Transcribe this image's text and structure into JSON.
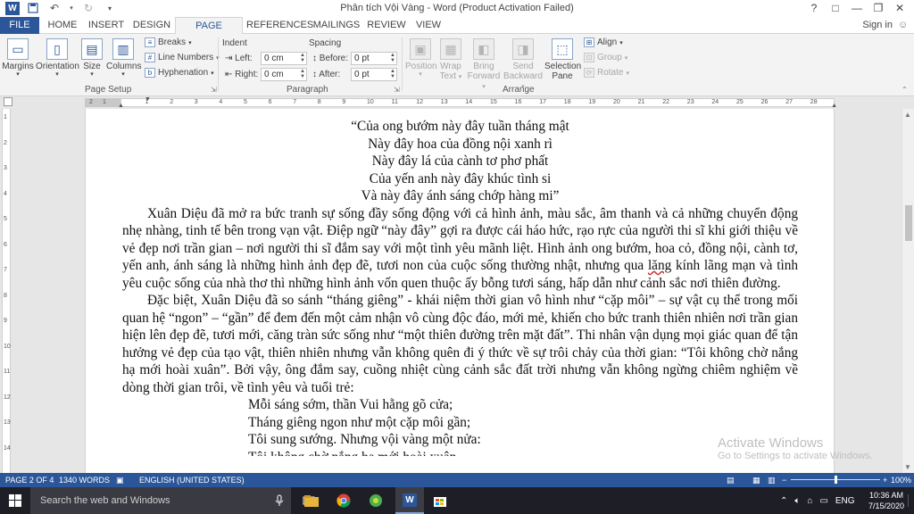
{
  "window": {
    "title": "Phân tích Vội Vàng - Word (Product Activation Failed)",
    "help": "?",
    "controls": [
      "□",
      "—",
      "❐",
      "✕"
    ]
  },
  "tabs": [
    "FILE",
    "HOME",
    "INSERT",
    "DESIGN",
    "PAGE LAYOUT",
    "REFERENCES",
    "MAILINGS",
    "REVIEW",
    "VIEW"
  ],
  "active_tab": "PAGE LAYOUT",
  "signin": "Sign in",
  "ribbon": {
    "page_setup": {
      "label": "Page Setup",
      "margins": "Margins",
      "orientation": "Orientation",
      "size": "Size",
      "columns": "Columns",
      "breaks": "Breaks",
      "line_numbers": "Line Numbers",
      "hyphenation": "Hyphenation"
    },
    "paragraph": {
      "label": "Paragraph",
      "indent_label": "Indent",
      "spacing_label": "Spacing",
      "left_label": "Left:",
      "right_label": "Right:",
      "before_label": "Before:",
      "after_label": "After:",
      "left_value": "0 cm",
      "right_value": "0 cm",
      "before_value": "0 pt",
      "after_value": "0 pt"
    },
    "arrange": {
      "label": "Arrange",
      "position": "Position",
      "wrap_text_1": "Wrap",
      "wrap_text_2": "Text",
      "bring_forward_1": "Bring",
      "bring_forward_2": "Forward",
      "send_backward_1": "Send",
      "send_backward_2": "Backward",
      "selection_pane_1": "Selection",
      "selection_pane_2": "Pane",
      "align": "Align",
      "group": "Group",
      "rotate": "Rotate"
    }
  },
  "ruler_numbers": [
    "1",
    "2",
    "1",
    "2",
    "3",
    "4",
    "5",
    "6",
    "7",
    "8",
    "9",
    "10",
    "11",
    "12",
    "13",
    "14",
    "15",
    "16",
    "17",
    "18",
    "19",
    "20",
    "21",
    "22",
    "23",
    "24",
    "25",
    "26",
    "27",
    "28"
  ],
  "vruler_numbers": [
    "1",
    "2",
    "3",
    "4",
    "5",
    "6",
    "7",
    "8",
    "9",
    "10",
    "11",
    "12",
    "13",
    "14"
  ],
  "document": {
    "poem1": [
      "“Của ong bướm này đây tuần tháng mật",
      "Này đây hoa của đồng nội xanh rì",
      "Này đây lá của cành tơ phơ phất",
      "Của yến anh này đây khúc tình si",
      "Và này đây ánh sáng chớp hàng mi”"
    ],
    "para1_before": "Xuân Diệu đã mở ra bức tranh sự sống đầy sống động với cả hình ảnh, màu sắc, âm thanh và cả những chuyển động nhẹ nhàng, tinh tế bên trong vạn vật. Điệp ngữ “này đây” gợi ra được cái háo hức, rạo rực của người thi sĩ khi giới thiệu về vẻ đẹp nơi trần gian – nơi người thi sĩ đắm say với một tình yêu mãnh liệt. Hình ảnh ong bướm, hoa cỏ, đồng nội, cành tơ, yến anh, ánh sáng là những hình ảnh đẹp đẽ, tươi non của cuộc sống thường nhật, nhưng qua ",
    "para1_squig": "lăng",
    "para1_after": " kính lãng mạn và tình yêu cuộc sống của nhà thơ thì những hình ảnh vốn quen thuộc ấy bỗng tươi sáng, hấp dẫn như cảnh sắc nơi thiên đường.",
    "para2": "Đặc biệt, Xuân Diệu đã so sánh “tháng giêng” - khái niệm thời gian vô hình như “cặp môi” – sự vật cụ thể trong mối quan hệ “ngon” – “gần” để đem đến một cảm nhận vô cùng độc đáo, mới mẻ, khiến cho bức tranh thiên nhiên nơi trần gian hiện lên đẹp đẽ, tươi mới, căng tràn sức sống như “một thiên đường trên mặt đất”. Thi nhân vận dụng mọi giác quan để tận hưởng vẻ đẹp của tạo vật, thiên nhiên nhưng vẫn không quên đi ý thức về sự trôi chảy của thời gian: “Tôi không chờ nắng hạ mới hoài xuân”. Bởi vậy, ông đắm say, cuồng nhiệt cùng cảnh sắc đất trời nhưng vẫn không ngừng chiêm nghiệm về dòng thời gian trôi, về tình yêu và tuổi trẻ:",
    "poem2": [
      "Mỗi sáng sớm, thần Vui hằng gõ cửa;",
      "Tháng giêng ngon như một cặp môi gần;",
      "Tôi sung sướng. Nhưng vội vàng một nửa:",
      "Tôi không chờ nắng hạ mới hoài xuân."
    ]
  },
  "watermark": {
    "title": "Activate Windows",
    "sub": "Go to Settings to activate Windows."
  },
  "status": {
    "page": "PAGE 2 OF 4",
    "words": "1340 WORDS",
    "language": "ENGLISH (UNITED STATES)",
    "zoom": "100%",
    "zoom_minus": "−",
    "zoom_plus": "+"
  },
  "taskbar": {
    "search_placeholder": "Search the web and Windows",
    "tray_lang": "ENG",
    "time": "10:36 AM",
    "date": "7/15/2020"
  },
  "colors": {
    "accent": "#2b579a",
    "taskbar": "#1e1f26"
  }
}
